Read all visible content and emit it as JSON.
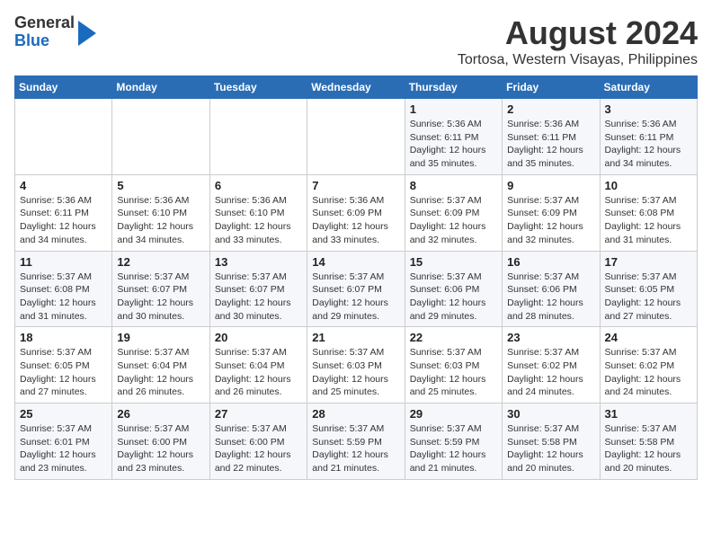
{
  "logo": {
    "line1": "General",
    "line2": "Blue"
  },
  "title": "August 2024",
  "subtitle": "Tortosa, Western Visayas, Philippines",
  "days": [
    "Sunday",
    "Monday",
    "Tuesday",
    "Wednesday",
    "Thursday",
    "Friday",
    "Saturday"
  ],
  "weeks": [
    [
      {
        "date": "",
        "info": ""
      },
      {
        "date": "",
        "info": ""
      },
      {
        "date": "",
        "info": ""
      },
      {
        "date": "",
        "info": ""
      },
      {
        "date": "1",
        "info": "Sunrise: 5:36 AM\nSunset: 6:11 PM\nDaylight: 12 hours and 35 minutes."
      },
      {
        "date": "2",
        "info": "Sunrise: 5:36 AM\nSunset: 6:11 PM\nDaylight: 12 hours and 35 minutes."
      },
      {
        "date": "3",
        "info": "Sunrise: 5:36 AM\nSunset: 6:11 PM\nDaylight: 12 hours and 34 minutes."
      }
    ],
    [
      {
        "date": "4",
        "info": "Sunrise: 5:36 AM\nSunset: 6:11 PM\nDaylight: 12 hours and 34 minutes."
      },
      {
        "date": "5",
        "info": "Sunrise: 5:36 AM\nSunset: 6:10 PM\nDaylight: 12 hours and 34 minutes."
      },
      {
        "date": "6",
        "info": "Sunrise: 5:36 AM\nSunset: 6:10 PM\nDaylight: 12 hours and 33 minutes."
      },
      {
        "date": "7",
        "info": "Sunrise: 5:36 AM\nSunset: 6:09 PM\nDaylight: 12 hours and 33 minutes."
      },
      {
        "date": "8",
        "info": "Sunrise: 5:37 AM\nSunset: 6:09 PM\nDaylight: 12 hours and 32 minutes."
      },
      {
        "date": "9",
        "info": "Sunrise: 5:37 AM\nSunset: 6:09 PM\nDaylight: 12 hours and 32 minutes."
      },
      {
        "date": "10",
        "info": "Sunrise: 5:37 AM\nSunset: 6:08 PM\nDaylight: 12 hours and 31 minutes."
      }
    ],
    [
      {
        "date": "11",
        "info": "Sunrise: 5:37 AM\nSunset: 6:08 PM\nDaylight: 12 hours and 31 minutes."
      },
      {
        "date": "12",
        "info": "Sunrise: 5:37 AM\nSunset: 6:07 PM\nDaylight: 12 hours and 30 minutes."
      },
      {
        "date": "13",
        "info": "Sunrise: 5:37 AM\nSunset: 6:07 PM\nDaylight: 12 hours and 30 minutes."
      },
      {
        "date": "14",
        "info": "Sunrise: 5:37 AM\nSunset: 6:07 PM\nDaylight: 12 hours and 29 minutes."
      },
      {
        "date": "15",
        "info": "Sunrise: 5:37 AM\nSunset: 6:06 PM\nDaylight: 12 hours and 29 minutes."
      },
      {
        "date": "16",
        "info": "Sunrise: 5:37 AM\nSunset: 6:06 PM\nDaylight: 12 hours and 28 minutes."
      },
      {
        "date": "17",
        "info": "Sunrise: 5:37 AM\nSunset: 6:05 PM\nDaylight: 12 hours and 27 minutes."
      }
    ],
    [
      {
        "date": "18",
        "info": "Sunrise: 5:37 AM\nSunset: 6:05 PM\nDaylight: 12 hours and 27 minutes."
      },
      {
        "date": "19",
        "info": "Sunrise: 5:37 AM\nSunset: 6:04 PM\nDaylight: 12 hours and 26 minutes."
      },
      {
        "date": "20",
        "info": "Sunrise: 5:37 AM\nSunset: 6:04 PM\nDaylight: 12 hours and 26 minutes."
      },
      {
        "date": "21",
        "info": "Sunrise: 5:37 AM\nSunset: 6:03 PM\nDaylight: 12 hours and 25 minutes."
      },
      {
        "date": "22",
        "info": "Sunrise: 5:37 AM\nSunset: 6:03 PM\nDaylight: 12 hours and 25 minutes."
      },
      {
        "date": "23",
        "info": "Sunrise: 5:37 AM\nSunset: 6:02 PM\nDaylight: 12 hours and 24 minutes."
      },
      {
        "date": "24",
        "info": "Sunrise: 5:37 AM\nSunset: 6:02 PM\nDaylight: 12 hours and 24 minutes."
      }
    ],
    [
      {
        "date": "25",
        "info": "Sunrise: 5:37 AM\nSunset: 6:01 PM\nDaylight: 12 hours and 23 minutes."
      },
      {
        "date": "26",
        "info": "Sunrise: 5:37 AM\nSunset: 6:00 PM\nDaylight: 12 hours and 23 minutes."
      },
      {
        "date": "27",
        "info": "Sunrise: 5:37 AM\nSunset: 6:00 PM\nDaylight: 12 hours and 22 minutes."
      },
      {
        "date": "28",
        "info": "Sunrise: 5:37 AM\nSunset: 5:59 PM\nDaylight: 12 hours and 21 minutes."
      },
      {
        "date": "29",
        "info": "Sunrise: 5:37 AM\nSunset: 5:59 PM\nDaylight: 12 hours and 21 minutes."
      },
      {
        "date": "30",
        "info": "Sunrise: 5:37 AM\nSunset: 5:58 PM\nDaylight: 12 hours and 20 minutes."
      },
      {
        "date": "31",
        "info": "Sunrise: 5:37 AM\nSunset: 5:58 PM\nDaylight: 12 hours and 20 minutes."
      }
    ]
  ]
}
